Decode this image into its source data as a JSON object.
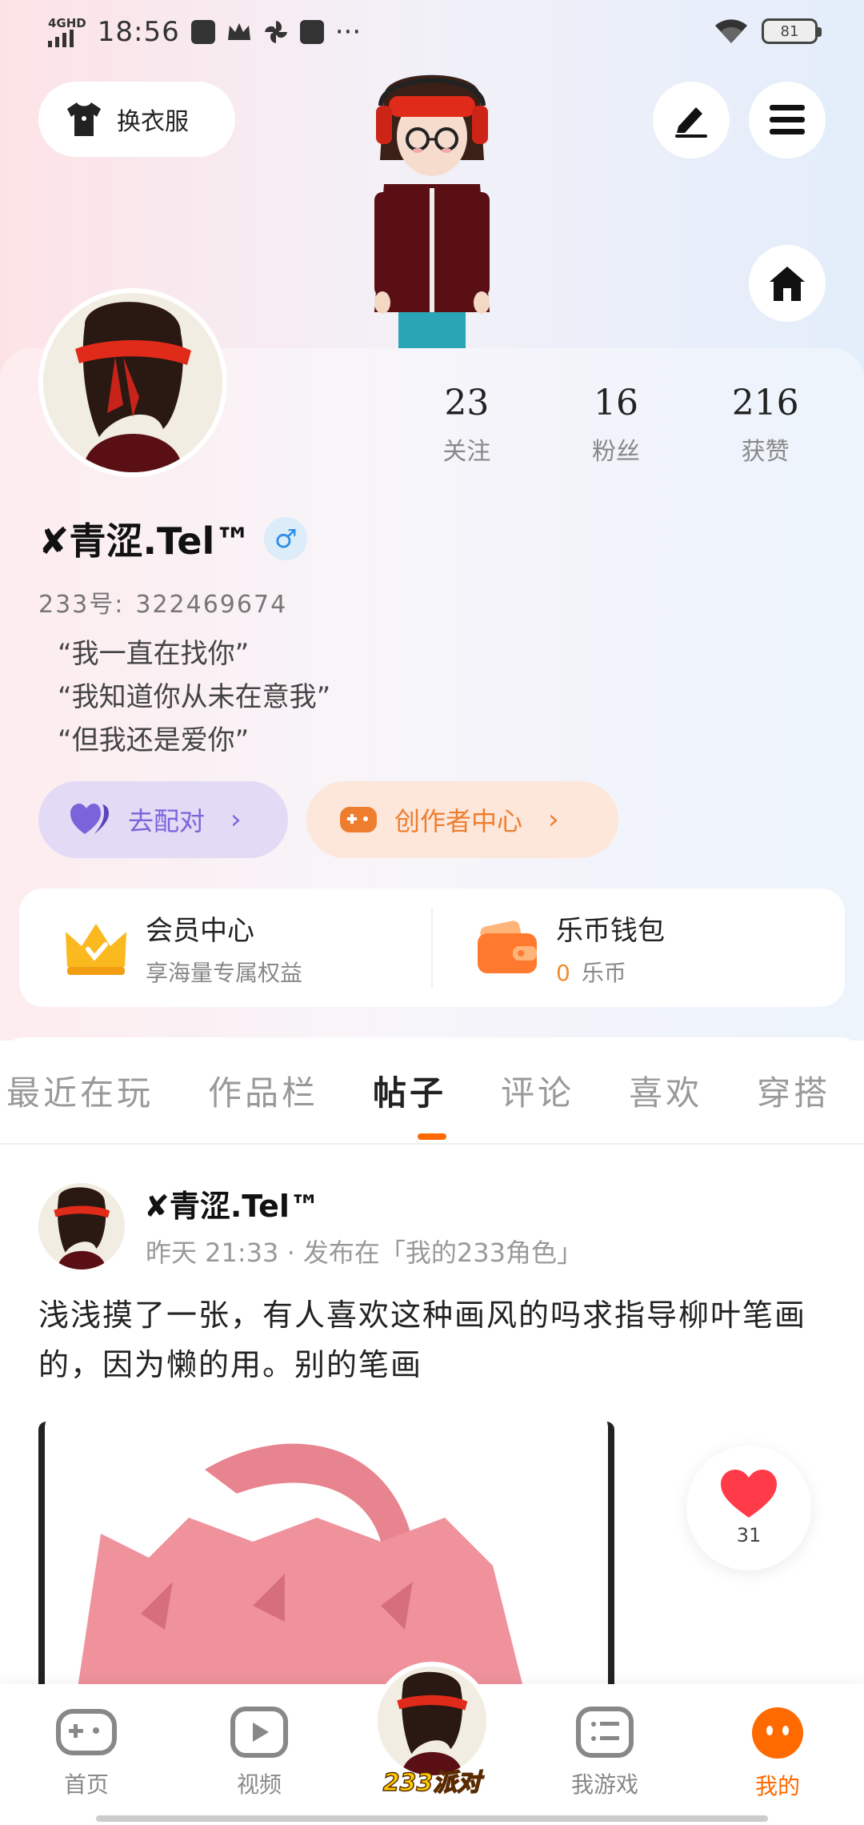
{
  "status_bar": {
    "network": "4GHD",
    "time": "18:56",
    "more": "···",
    "battery": "81"
  },
  "top": {
    "outfit_label": "换衣服"
  },
  "stats": [
    {
      "value": "23",
      "label": "关注"
    },
    {
      "value": "16",
      "label": "粉丝"
    },
    {
      "value": "216",
      "label": "获赞"
    }
  ],
  "profile": {
    "username": "✘青涩.Tel™",
    "gender_symbol": "♂",
    "uid_label": "233号:",
    "uid_value": "322469674",
    "bio_lines": [
      "“我一直在找你”",
      "“我知道你从未在意我”",
      "“但我还是爱你”"
    ]
  },
  "actions": {
    "pair_label": "去配对",
    "creator_label": "创作者中心",
    "chevron": "›"
  },
  "member": {
    "title": "会员中心",
    "subtitle": "享海量专属权益"
  },
  "wallet": {
    "title": "乐币钱包",
    "amount": "0",
    "unit": "乐币"
  },
  "tabs": [
    "最近在玩",
    "作品栏",
    "帖子",
    "评论",
    "喜欢",
    "穿搭"
  ],
  "active_tab": "帖子",
  "post": {
    "author": "✘青涩.Tel™",
    "meta": "昨天 21:33 · 发布在「我的233角色」",
    "text": "浅浅摸了一张，有人喜欢这种画风的吗求指导柳叶笔画的，因为懒的用。别的笔画",
    "likes": "31"
  },
  "bottom_nav": {
    "home": "首页",
    "video": "视频",
    "party": "233派对",
    "my_games": "我游戏",
    "mine": "我的"
  },
  "colors": {
    "accent": "#ff6a00",
    "pair": "#7b63d9",
    "creator": "#ef7d2e",
    "like": "#ff3b4a"
  }
}
